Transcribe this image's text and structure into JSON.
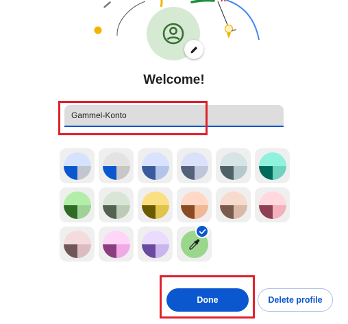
{
  "header": {
    "title": "Welcome!",
    "avatar_icon": "person-icon",
    "edit_icon": "pencil-icon"
  },
  "name_field": {
    "value": "Gammel-Konto"
  },
  "theme_swatches": [
    {
      "top": "#d5e3ff",
      "left": "#0b57d0",
      "right": "#c2c7cf"
    },
    {
      "top": "#e3e3e3",
      "left": "#0b57d0",
      "right": "#c7c7c7"
    },
    {
      "top": "#d9e2ff",
      "left": "#3a5a9e",
      "right": "#b4c3ea"
    },
    {
      "top": "#dbe1fb",
      "left": "#55607a",
      "right": "#bfc6dc"
    },
    {
      "top": "#d6e4e6",
      "left": "#4e6266",
      "right": "#b5c9cb"
    },
    {
      "top": "#8ff2dd",
      "left": "#006b5a",
      "right": "#6fd3be"
    },
    {
      "top": "#b3eea8",
      "left": "#2f6b25",
      "right": "#9fd296"
    },
    {
      "top": "#d9e6d6",
      "left": "#546251",
      "right": "#bccbb8"
    },
    {
      "top": "#fbe083",
      "left": "#6a5b00",
      "right": "#e0c44b"
    },
    {
      "top": "#ffd9c6",
      "left": "#8c4a22",
      "right": "#f0b895"
    },
    {
      "top": "#f7dbcd",
      "left": "#7a5a4c",
      "right": "#dbb9a8"
    },
    {
      "top": "#ffd9de",
      "left": "#8f3f52",
      "right": "#f3b0bd"
    },
    {
      "top": "#f4dcde",
      "left": "#6f5659",
      "right": "#dbbcbf"
    },
    {
      "top": "#ffd6f7",
      "left": "#8a3e80",
      "right": "#f0a9e4"
    },
    {
      "top": "#eadbff",
      "left": "#6a4a9e",
      "right": "#cbb5ef"
    }
  ],
  "custom_swatch": {
    "icon": "eyedropper-icon",
    "selected_icon": "checkmark-icon",
    "color": "#9bd68d"
  },
  "actions": {
    "done_label": "Done",
    "delete_label": "Delete profile"
  },
  "colors": {
    "accent": "#0b57d0",
    "highlight": "#e0202a"
  }
}
